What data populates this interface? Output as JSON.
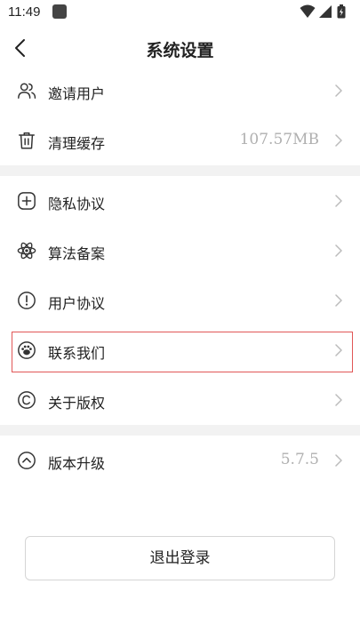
{
  "status_bar": {
    "time": "11:49"
  },
  "header": {
    "title": "系统设置"
  },
  "group1": {
    "items": [
      {
        "label": "邀请用户",
        "icon": "invite-users-icon"
      },
      {
        "label": "清理缓存",
        "value": "107.57MB",
        "icon": "trash-icon"
      }
    ]
  },
  "group2": {
    "items": [
      {
        "label": "隐私协议",
        "icon": "plus-square-icon"
      },
      {
        "label": "算法备案",
        "icon": "atom-icon"
      },
      {
        "label": "用户协议",
        "icon": "exclamation-circle-icon"
      },
      {
        "label": "联系我们",
        "icon": "paw-icon",
        "highlighted": true
      },
      {
        "label": "关于版权",
        "icon": "copyright-icon"
      }
    ]
  },
  "group3": {
    "items": [
      {
        "label": "版本升级",
        "value": "5.7.5",
        "icon": "chevron-up-circle-icon"
      }
    ]
  },
  "logout_label": "退出登录",
  "colors": {
    "highlight_border": "#e05656",
    "divider": "#f2f2f2",
    "value_text": "#b0b0b0"
  }
}
